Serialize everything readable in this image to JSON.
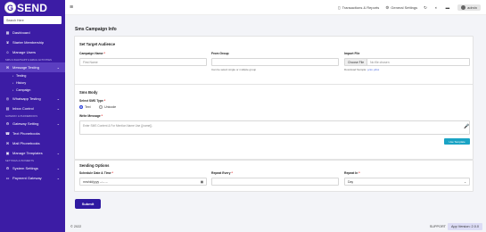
{
  "brand": {
    "logo_letter": "G",
    "logo_text": "SEND"
  },
  "sidebar": {
    "search_placeholder": "Search Here",
    "items_top": [
      {
        "label": "Dashboard",
        "icon": "grid-icon"
      },
      {
        "label": "Starter Membership",
        "icon": "crown-icon"
      },
      {
        "label": "Manage Users",
        "icon": "users-icon"
      }
    ],
    "section_sms": "SMS & WHATSAPP & EMAIL ACTIVITIES",
    "message_testing": {
      "label": "Message Testing",
      "icon": "message-icon"
    },
    "sub_items": [
      {
        "label": "Testing"
      },
      {
        "label": "History"
      },
      {
        "label": "Campaign"
      }
    ],
    "items_mid": [
      {
        "label": "Whatsapp Testing",
        "icon": "whatsapp-icon"
      },
      {
        "label": "Inbox Control",
        "icon": "inbox-icon"
      }
    ],
    "section_gateway": "GATEWAY & PHONEBOOKS",
    "items_gateway": [
      {
        "label": "Gateway Setting",
        "icon": "gateway-icon"
      },
      {
        "label": "Text Phonebooks",
        "icon": "phonebook-icon"
      },
      {
        "label": "Mail Phonebooks",
        "icon": "mail-icon"
      },
      {
        "label": "Manage Templates",
        "icon": "template-icon"
      }
    ],
    "section_settings": "SETTINGS & PAYMENTS",
    "items_settings": [
      {
        "label": "System Settings",
        "icon": "gear-icon"
      },
      {
        "label": "Payment Gateway",
        "icon": "card-icon"
      }
    ]
  },
  "header": {
    "transactions": "Transactions & Reports",
    "settings": "General Settings",
    "admin": "admin"
  },
  "page": {
    "title": "Sms Campaign Info"
  },
  "target": {
    "title": "Set Target Audience",
    "campaign_label": "Campaign Name",
    "campaign_placeholder": "First Name",
    "group_label": "From Group",
    "group_hint": "Can be select single or multiple group",
    "import_label": "Import File",
    "file_button": "Choose File",
    "file_value": "No file chosen",
    "download_prefix": "Download Sample:",
    "download_csv": "csv",
    "download_xlsx": "xlsx"
  },
  "body_section": {
    "title": "Sms Body",
    "type_label": "Select SMS Type",
    "type_text": "Text",
    "type_unicode": "Unicode",
    "message_label": "Write Message",
    "message_placeholder": "Enter SMS Content & For Mention Name Use {{name}}",
    "template_button": "Use Template"
  },
  "sending": {
    "title": "Sending Options",
    "schedule_label": "Schedule Date & Time",
    "schedule_value": "mm/dd/yyyy --:-- --",
    "repeat_label": "Repeat Every",
    "repeat_in_label": "Repeat In",
    "repeat_in_value": "Day"
  },
  "submit_label": "Submit",
  "footer": {
    "copyright": "© 2022",
    "support": "SUPPORT",
    "version": "App Version: 2.0.0"
  }
}
